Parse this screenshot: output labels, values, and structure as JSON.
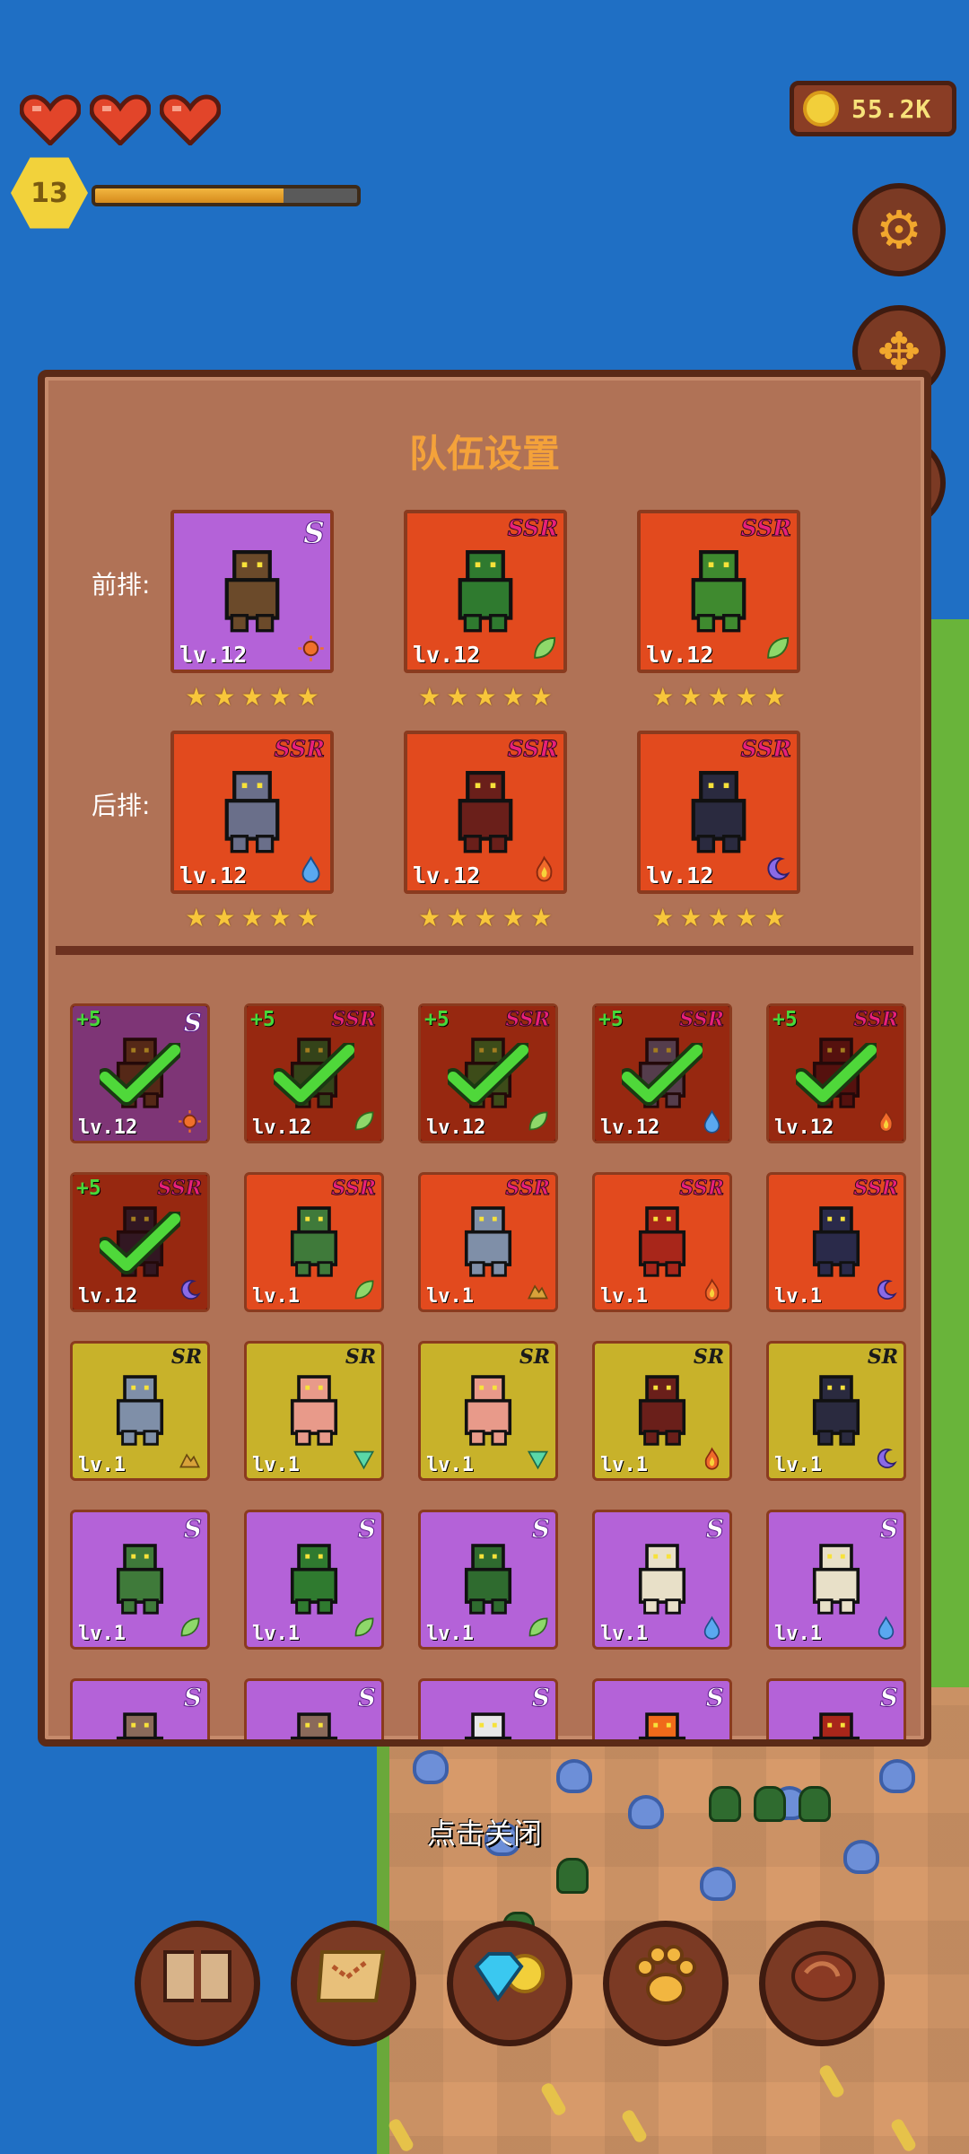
{
  "hud": {
    "hearts": 3,
    "level": "13",
    "xp_fraction": 0.72,
    "coins": "55.2K"
  },
  "side_buttons": [
    "gear-icon",
    "move-arrows-icon"
  ],
  "panel": {
    "title": "队伍设置",
    "front_label": "前排:",
    "back_label": "后排:",
    "front": [
      {
        "rarity": "S",
        "level": "lv.12",
        "element": "sun",
        "bg": "#b462d8",
        "stars": 5,
        "sprite": "deer-spear"
      },
      {
        "rarity": "SSR",
        "level": "lv.12",
        "element": "leaf",
        "bg": "#e24a1e",
        "stars": 5,
        "sprite": "treant"
      },
      {
        "rarity": "SSR",
        "level": "lv.12",
        "element": "leaf",
        "bg": "#e24a1e",
        "stars": 5,
        "sprite": "sprout"
      }
    ],
    "back": [
      {
        "rarity": "SSR",
        "level": "lv.12",
        "element": "water",
        "bg": "#e24a1e",
        "stars": 5,
        "sprite": "wolf-rider"
      },
      {
        "rarity": "SSR",
        "level": "lv.12",
        "element": "fire",
        "bg": "#e24a1e",
        "stars": 5,
        "sprite": "demon"
      },
      {
        "rarity": "SSR",
        "level": "lv.12",
        "element": "moon",
        "bg": "#e24a1e",
        "stars": 5,
        "sprite": "dark-knight"
      }
    ]
  },
  "roster": [
    {
      "rarity": "S",
      "level": "lv.12",
      "element": "sun",
      "bg": "#b462d8",
      "plus": "+5",
      "selected": true,
      "sprite": "deer-spear"
    },
    {
      "rarity": "SSR",
      "level": "lv.12",
      "element": "leaf",
      "bg": "#e24a1e",
      "plus": "+5",
      "selected": true,
      "sprite": "treant"
    },
    {
      "rarity": "SSR",
      "level": "lv.12",
      "element": "leaf",
      "bg": "#e24a1e",
      "plus": "+5",
      "selected": true,
      "sprite": "sprout"
    },
    {
      "rarity": "SSR",
      "level": "lv.12",
      "element": "water",
      "bg": "#e24a1e",
      "plus": "+5",
      "selected": true,
      "sprite": "wolf-rider"
    },
    {
      "rarity": "SSR",
      "level": "lv.12",
      "element": "fire",
      "bg": "#e24a1e",
      "plus": "+5",
      "selected": true,
      "sprite": "demon"
    },
    {
      "rarity": "SSR",
      "level": "lv.12",
      "element": "moon",
      "bg": "#e24a1e",
      "plus": "+5",
      "selected": true,
      "sprite": "dark-knight"
    },
    {
      "rarity": "SSR",
      "level": "lv.1",
      "element": "leaf",
      "bg": "#e24a1e",
      "plus": "",
      "selected": false,
      "sprite": "goblin-axes"
    },
    {
      "rarity": "SSR",
      "level": "lv.1",
      "element": "earth",
      "bg": "#e24a1e",
      "plus": "",
      "selected": false,
      "sprite": "golem"
    },
    {
      "rarity": "SSR",
      "level": "lv.1",
      "element": "fire",
      "bg": "#e24a1e",
      "plus": "",
      "selected": false,
      "sprite": "horned-demon"
    },
    {
      "rarity": "SSR",
      "level": "lv.1",
      "element": "moon",
      "bg": "#e24a1e",
      "plus": "",
      "selected": false,
      "sprite": "hooded-shade"
    },
    {
      "rarity": "SR",
      "level": "lv.1",
      "element": "earth",
      "bg": "#c8b22a",
      "plus": "",
      "selected": false,
      "sprite": "golem"
    },
    {
      "rarity": "SR",
      "level": "lv.1",
      "element": "wind",
      "bg": "#c8b22a",
      "plus": "",
      "selected": false,
      "sprite": "girl"
    },
    {
      "rarity": "SR",
      "level": "lv.1",
      "element": "wind",
      "bg": "#c8b22a",
      "plus": "",
      "selected": false,
      "sprite": "girl"
    },
    {
      "rarity": "SR",
      "level": "lv.1",
      "element": "fire",
      "bg": "#c8b22a",
      "plus": "",
      "selected": false,
      "sprite": "demon"
    },
    {
      "rarity": "SR",
      "level": "lv.1",
      "element": "moon",
      "bg": "#c8b22a",
      "plus": "",
      "selected": false,
      "sprite": "dark-knight"
    },
    {
      "rarity": "S",
      "level": "lv.1",
      "element": "leaf",
      "bg": "#b462d8",
      "plus": "",
      "selected": false,
      "sprite": "goblin-axes"
    },
    {
      "rarity": "S",
      "level": "lv.1",
      "element": "leaf",
      "bg": "#b462d8",
      "plus": "",
      "selected": false,
      "sprite": "treant"
    },
    {
      "rarity": "S",
      "level": "lv.1",
      "element": "leaf",
      "bg": "#b462d8",
      "plus": "",
      "selected": false,
      "sprite": "goblin"
    },
    {
      "rarity": "S",
      "level": "lv.1",
      "element": "water",
      "bg": "#b462d8",
      "plus": "",
      "selected": false,
      "sprite": "elf-mage"
    },
    {
      "rarity": "S",
      "level": "lv.1",
      "element": "water",
      "bg": "#b462d8",
      "plus": "",
      "selected": false,
      "sprite": "elf-mage"
    },
    {
      "rarity": "S",
      "level": "",
      "element": "",
      "bg": "#b462d8",
      "plus": "",
      "selected": false,
      "sprite": "rock"
    },
    {
      "rarity": "S",
      "level": "",
      "element": "",
      "bg": "#b462d8",
      "plus": "",
      "selected": false,
      "sprite": "rock"
    },
    {
      "rarity": "S",
      "level": "",
      "element": "",
      "bg": "#b462d8",
      "plus": "",
      "selected": false,
      "sprite": "skull"
    },
    {
      "rarity": "S",
      "level": "",
      "element": "",
      "bg": "#b462d8",
      "plus": "",
      "selected": false,
      "sprite": "flame"
    },
    {
      "rarity": "S",
      "level": "",
      "element": "",
      "bg": "#b462d8",
      "plus": "",
      "selected": false,
      "sprite": "horned-demon"
    }
  ],
  "close_hint": "点击关闭",
  "bottom_nav": [
    "book-icon",
    "map-scroll-icon",
    "gem-coin-icon",
    "paw-icon",
    "meat-icon"
  ]
}
